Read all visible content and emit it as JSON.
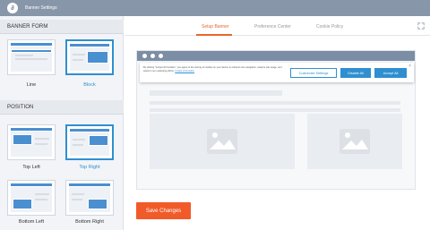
{
  "app": {
    "title": "Banner Settings",
    "logo_glyph": "∂"
  },
  "sidebar": {
    "banner_form": {
      "heading": "BANNER FORM",
      "options": [
        {
          "label": "Line",
          "selected": false
        },
        {
          "label": "Block",
          "selected": true
        }
      ]
    },
    "position": {
      "heading": "POSITION",
      "options": [
        {
          "label": "Top Left",
          "selected": false
        },
        {
          "label": "Top Right",
          "selected": true
        },
        {
          "label": "Bottom Left",
          "selected": false
        },
        {
          "label": "Bottom Right",
          "selected": false
        }
      ]
    }
  },
  "tabs": [
    {
      "label": "Setup Banner",
      "active": true
    },
    {
      "label": "Preference Center",
      "active": false
    },
    {
      "label": "Cookie Policy",
      "active": false
    }
  ],
  "preview": {
    "banner_text": "By clicking \"Accept All Cookies\", you agree to the storing of cookies on your device to enhance site navigation, analyze site usage, and assist in our marketing efforts.",
    "banner_link": "Cookie information",
    "customize_label": "Customize Settings",
    "disable_label": "Disable All",
    "accept_label": "Accept All",
    "close_glyph": "×"
  },
  "actions": {
    "save_label": "Save Changes"
  },
  "icons": {
    "logo": "app-logo-icon",
    "fullscreen": "expand-icon",
    "close": "close-icon",
    "image": "image-placeholder-icon"
  },
  "colors": {
    "topbar": "#8796a8",
    "accent_blue": "#2f8fd0",
    "accent_orange": "#e8672c",
    "save_button": "#f15b2a"
  }
}
